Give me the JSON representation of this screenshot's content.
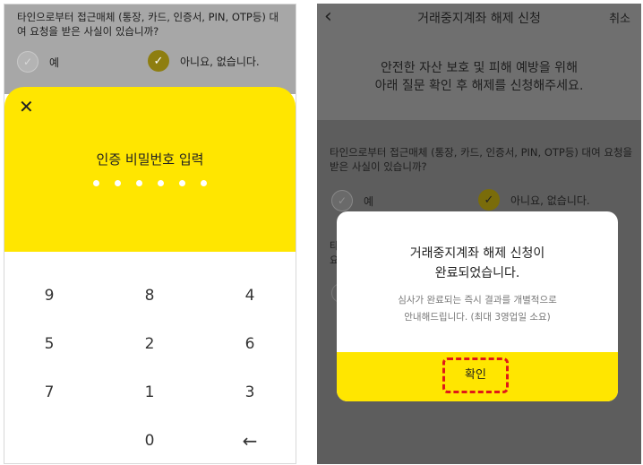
{
  "left": {
    "question": "타인으로부터 접근매체 (통장, 카드, 인증서, PIN, OTP등) 대여 요청을 받은 사실이 있습니까?",
    "option_yes": "예",
    "option_no": "아니요, 없습니다.",
    "selected": "아니요, 없습니다.",
    "sheet": {
      "close_icon": "close-icon",
      "title": "인증 비밀번호 입력",
      "pin_digits_entered": 6
    },
    "keypad": {
      "rows": [
        [
          "9",
          "8",
          "4"
        ],
        [
          "5",
          "2",
          "6"
        ],
        [
          "7",
          "1",
          "3"
        ],
        [
          "",
          "0",
          "←"
        ]
      ]
    }
  },
  "right": {
    "header": {
      "back_icon": "chevron-left-icon",
      "title": "거래중지계좌 해제 신청",
      "cancel": "취소"
    },
    "intro_line1": "안전한 자산 보호 및 피해 예방을 위해",
    "intro_line2": "아래 질문 확인 후 해제를 신청해주세요.",
    "question": "타인으로부터 접근매체 (통장, 카드, 인증서, PIN, OTP등) 대여 요청을 받은 사실이 있습니까?",
    "option_yes": "예",
    "option_no": "아니요, 없습니다.",
    "dialog": {
      "title_line1": "거래중지계좌 해제 신청이",
      "title_line2": "완료되었습니다.",
      "desc_line1": "심사가 완료되는 즉시 결과를 개별적으로",
      "desc_line2": "안내해드립니다. (최대 3영업일 소요)",
      "confirm": "확인"
    }
  },
  "colors": {
    "accent_yellow": "#ffe600",
    "highlight_red": "#e01818",
    "dim_overlay": "#6f6f6f"
  }
}
